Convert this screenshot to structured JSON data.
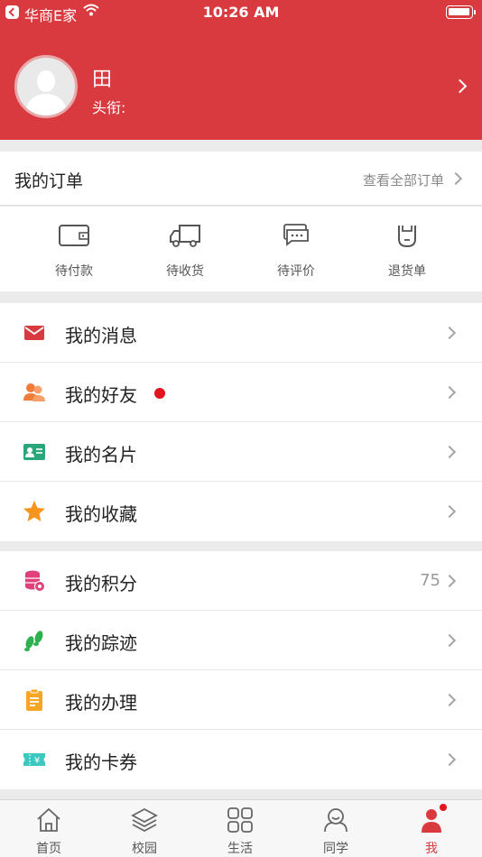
{
  "status_bar": {
    "carrier": "华商E家",
    "time": "10:26 AM"
  },
  "profile": {
    "name": "田",
    "title": "头衔:"
  },
  "orders": {
    "title": "我的订单",
    "view_all": "查看全部订单",
    "items": [
      {
        "label": "待付款",
        "icon": "wallet-icon"
      },
      {
        "label": "待收货",
        "icon": "truck-icon"
      },
      {
        "label": "待评价",
        "icon": "comment-icon"
      },
      {
        "label": "退货单",
        "icon": "return-icon"
      }
    ]
  },
  "menu_group_1": [
    {
      "label": "我的消息",
      "icon": "envelope-icon",
      "color": "#d93a3f"
    },
    {
      "label": "我的好友",
      "icon": "friends-icon",
      "color": "#f07c3a",
      "badge": true
    },
    {
      "label": "我的名片",
      "icon": "business-card-icon",
      "color": "#2aa77a"
    },
    {
      "label": "我的收藏",
      "icon": "star-icon",
      "color": "#f7941d"
    }
  ],
  "menu_group_2": [
    {
      "label": "我的积分",
      "icon": "coins-icon",
      "color": "#e0417a",
      "value": "75"
    },
    {
      "label": "我的踪迹",
      "icon": "footprint-icon",
      "color": "#2fb050"
    },
    {
      "label": "我的办理",
      "icon": "clipboard-icon",
      "color": "#f5a623"
    },
    {
      "label": "我的卡券",
      "icon": "coupon-icon",
      "color": "#3cc8c0"
    }
  ],
  "tabbar": [
    {
      "label": "首页",
      "icon": "home-icon"
    },
    {
      "label": "校园",
      "icon": "layers-icon"
    },
    {
      "label": "生活",
      "icon": "grid-icon"
    },
    {
      "label": "同学",
      "icon": "classmates-icon"
    },
    {
      "label": "我",
      "icon": "person-icon",
      "active": true
    }
  ],
  "colors": {
    "brand_red": "#d93a3f",
    "badge_red": "#e4131d"
  }
}
